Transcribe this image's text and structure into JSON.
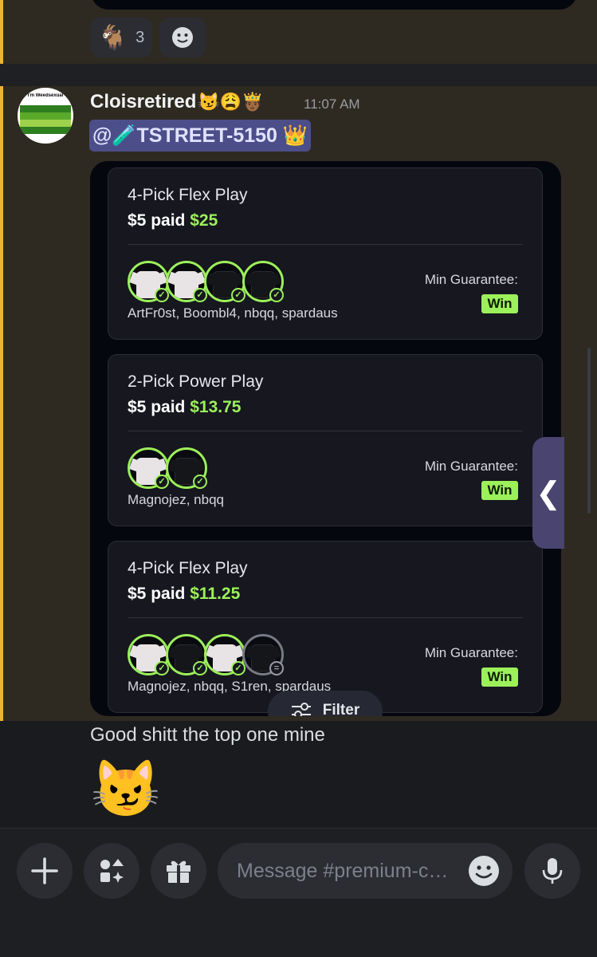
{
  "reactions": [
    {
      "emoji": "🐐",
      "count": "3"
    }
  ],
  "message": {
    "author": "Cloisretired",
    "author_badges": "😼😩🤴🏾",
    "timestamp": "11:07 AM",
    "mention": "@🧪TSTREET-5150 👑",
    "text": "Good shitt the top one mine",
    "big_emoji": "😼",
    "avatar_caption": "I'm Weedsexual",
    "avatar_colors": [
      "#2e7d1f",
      "#5aaa2a",
      "#9ed24a",
      "#2e7d1f"
    ]
  },
  "entries": [
    {
      "title": "4-Pick Flex Play",
      "paid": "$5 paid",
      "won": "$25",
      "players": "ArtFr0st, Boombl4, nbqq, spardaus",
      "min_label": "Min Guarantee:",
      "result": "Win",
      "picks": [
        {
          "jersey": "white",
          "status": "check"
        },
        {
          "jersey": "white",
          "status": "check"
        },
        {
          "jersey": "black",
          "status": "check"
        },
        {
          "jersey": "black",
          "status": "check"
        }
      ]
    },
    {
      "title": "2-Pick Power Play",
      "paid": "$5 paid",
      "won": "$13.75",
      "players": "Magnojez, nbqq",
      "min_label": "Min Guarantee:",
      "result": "Win",
      "picks": [
        {
          "jersey": "white",
          "status": "check"
        },
        {
          "jersey": "black",
          "status": "check"
        }
      ]
    },
    {
      "title": "4-Pick Flex Play",
      "paid": "$5 paid",
      "won": "$11.25",
      "players": "Magnojez, nbqq, S1ren, spardaus",
      "min_label": "Min Guarantee:",
      "result": "Win",
      "picks": [
        {
          "jersey": "white",
          "status": "check"
        },
        {
          "jersey": "black",
          "status": "check"
        },
        {
          "jersey": "white",
          "status": "check"
        },
        {
          "jersey": "black",
          "status": "pending"
        }
      ]
    }
  ],
  "filter_label": "Filter",
  "composer": {
    "placeholder": "Message #premium-c…"
  },
  "colors": {
    "mention_highlight": "#2e2a21",
    "mention_bar": "#f0b232",
    "win_green": "#9cf05a"
  },
  "icons": [
    "goat-emoji",
    "add-reaction-icon",
    "filter-icon",
    "chevron-left-icon",
    "plus-icon",
    "apps-icon",
    "gift-icon",
    "emoji-icon",
    "mic-icon"
  ]
}
